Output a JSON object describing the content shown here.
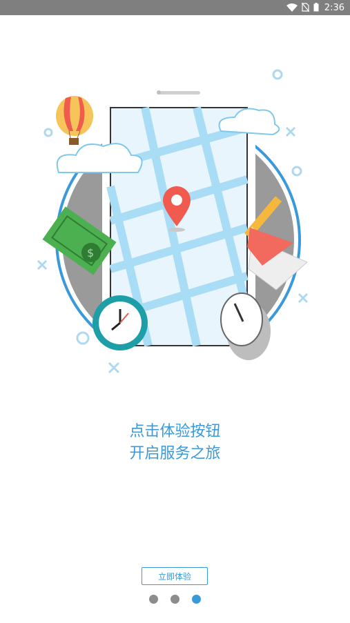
{
  "status_bar": {
    "time": "2:36",
    "icons": [
      "wifi-icon",
      "no-sim-icon",
      "battery-icon"
    ]
  },
  "onboarding": {
    "line1": "点击体验按钮",
    "line2": "开启服务之旅",
    "start_button_label": "立即体验",
    "page_count": 3,
    "current_page": 3
  },
  "colors": {
    "accent": "#3a9ad9",
    "status_bar_bg": "#7f7f7f",
    "dot_inactive": "#8c8c8c",
    "dot_active": "#3a9ad9",
    "pin": "#f05a4f",
    "map_road": "#a9dcf5"
  }
}
